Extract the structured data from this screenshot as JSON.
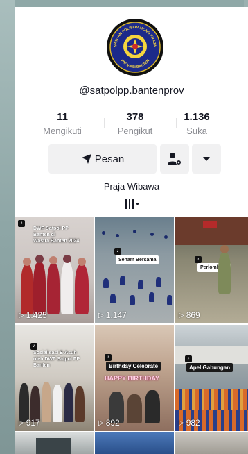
{
  "profile": {
    "handle": "@satpolpp.bantenprov",
    "logo_text_top": "SATUAN POLISI PAMONG PRAJA",
    "logo_text_bottom": "PROVINSI BANTEN",
    "bio": "Praja Wibawa"
  },
  "stats": [
    {
      "value": "11",
      "label": "Mengikuti"
    },
    {
      "value": "378",
      "label": "Pengikut"
    },
    {
      "value": "1.136",
      "label": "Suka"
    }
  ],
  "actions": {
    "message_label": "Pesan",
    "follow_icon": "person-gear-icon",
    "more_icon": "caret-down-icon"
  },
  "videos": [
    {
      "views": "1.425",
      "caption_lines": [
        "DWP Satpol PP",
        "Banten di",
        "Wastra Banten 2024"
      ]
    },
    {
      "views": "1.147",
      "caption": "Senam Bersama"
    },
    {
      "views": "869",
      "caption": "Perlombaan"
    },
    {
      "views": "917",
      "caption_lines": [
        "Sosialisasi E-Asuh",
        "oleh DWP Satpol PP",
        "Banten"
      ]
    },
    {
      "views": "892",
      "caption": "Birthday Celebrate",
      "banner": "HAPPY BIRTHDAY"
    },
    {
      "views": "982",
      "caption": "Apel Gabungan"
    }
  ],
  "colors": {
    "text_primary": "#161823",
    "text_secondary": "#8a8b91",
    "button_bg": "#f1f1f2"
  }
}
